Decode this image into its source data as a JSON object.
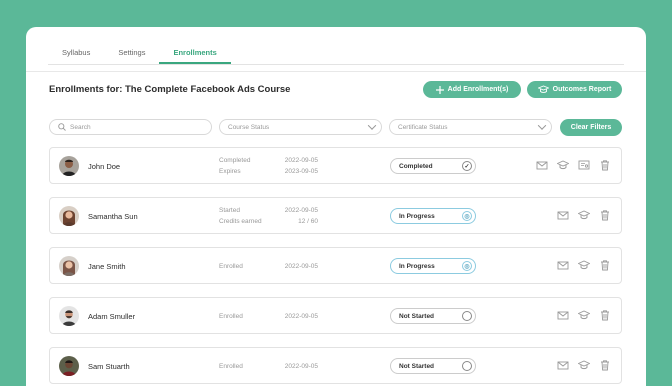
{
  "tabs": [
    {
      "label": "Syllabus"
    },
    {
      "label": "Settings"
    },
    {
      "label": "Enrollments"
    }
  ],
  "page_title": "Enrollments for: The Complete Facebook Ads Course",
  "buttons": {
    "add_enrollment": "Add Enrollment(s)",
    "outcomes_report": "Outcomes Report",
    "clear_filters": "Clear Filters"
  },
  "filters": {
    "search_placeholder": "Search",
    "course_status_placeholder": "Course Status",
    "certificate_status_placeholder": "Certificate Status"
  },
  "enrollments": [
    {
      "name": "John Doe",
      "label1": "Completed",
      "value1": "2022-09-05",
      "label2": "Expires",
      "value2": "2023-09-05",
      "status": "Completed",
      "status_icon": "check-icon",
      "has_certificate": true
    },
    {
      "name": "Samantha Sun",
      "label1": "Started",
      "value1": "2022-09-05",
      "label2": "Credits earned",
      "value2": "12 / 60",
      "status": "In Progress",
      "status_icon": "progress-icon",
      "has_certificate": false
    },
    {
      "name": "Jane Smith",
      "label1": "Enrolled",
      "value1": "2022-09-05",
      "label2": "",
      "value2": "",
      "status": "In Progress",
      "status_icon": "progress-icon",
      "has_certificate": false
    },
    {
      "name": "Adam Smuller",
      "label1": "Enrolled",
      "value1": "2022-09-05",
      "label2": "",
      "value2": "",
      "status": "Not Started",
      "status_icon": "empty-circle-icon",
      "has_certificate": false
    },
    {
      "name": "Sam Stuarth",
      "label1": "Enrolled",
      "value1": "2022-09-05",
      "label2": "",
      "value2": "",
      "status": "Not Started",
      "status_icon": "empty-circle-icon",
      "has_certificate": false
    }
  ],
  "colors": {
    "background": "#5bb898",
    "accent": "#3aa77f",
    "progress_border": "#8ccbe0"
  }
}
